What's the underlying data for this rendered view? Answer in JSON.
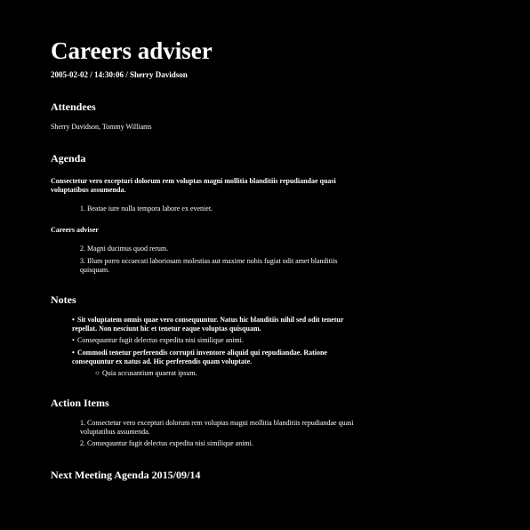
{
  "title": "Careers adviser",
  "meta": "2005-02-02 / 14:30:06 / Sherry Davidson",
  "attendees": {
    "heading": "Attendees",
    "names": "Sherry Davidson, Tommy Williams"
  },
  "agenda": {
    "heading": "Agenda",
    "topic1": "Consectetur vero excepturi dolorum rem voluptas magni mollitia blanditiis repudiandae quasi voluptatibus assumenda.",
    "items1": [
      "1. Beatae iure nulla tempora labore ex eveniet."
    ],
    "topic2": "Careers adviser",
    "items2": [
      "2. Magni ducimus quod rerum.",
      "3. Illum porro occaecati laboriosam molestias aut maxime nobis fugiat odit amet blanditiis quisquam."
    ]
  },
  "notes": {
    "heading": "Notes",
    "bullet_char": "•",
    "sub_bullet_char": "○",
    "items": [
      "Sit voluptatem omnis quae vero consequuntur. Natus hic blanditiis nihil sed odit tenetur repellat. Non nesciunt hic et tenetur eaque voluptas quisquam.",
      "Consequuntur fugit delectus expedita nisi similique animi.",
      "Commodi tenetur perferendis corrupti inventore aliquid qui repudiandae. Ratione consequuntur ex natus ad. Hic perferendis quam voluptate."
    ],
    "sub_items": [
      "Quia accusantium quaerat ipsum."
    ]
  },
  "action_items": {
    "heading": "Action Items",
    "items": [
      "1. Consectetur vero excepturi dolorum rem voluptas magni mollitia blanditiis repudiandae quasi voluptatibus assumenda.",
      "2. Consequuntur fugit delectus expedita nisi similique animi."
    ]
  },
  "next_meeting": {
    "heading": "Next Meeting Agenda 2015/09/14"
  }
}
